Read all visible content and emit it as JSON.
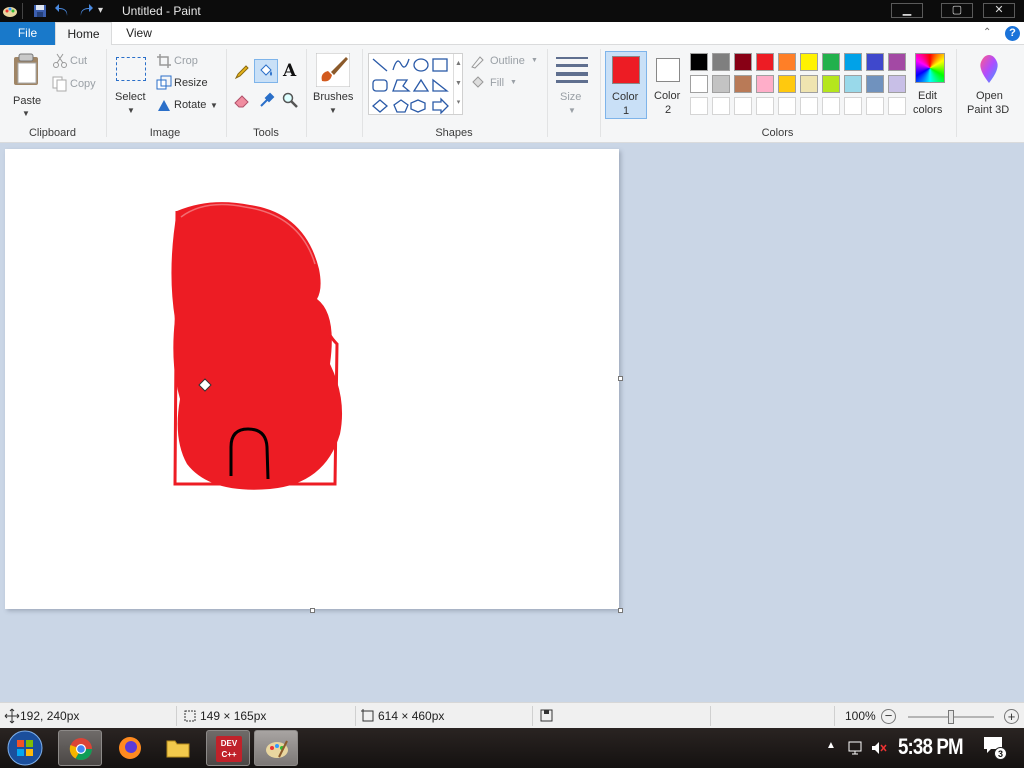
{
  "window": {
    "title": "Untitled - Paint",
    "minimize_symbol": "▁",
    "maximize_symbol": "▢",
    "close_symbol": "✕"
  },
  "menu": {
    "tabs": [
      {
        "label": "File"
      },
      {
        "label": "Home"
      },
      {
        "label": "View"
      }
    ],
    "help_symbol": "?"
  },
  "ribbon": {
    "clipboard": {
      "paste_label": "Paste",
      "cut_label": "Cut",
      "copy_label": "Copy",
      "group_label": "Clipboard"
    },
    "image": {
      "select_label": "Select",
      "crop_label": "Crop",
      "resize_label": "Resize",
      "rotate_label": "Rotate",
      "group_label": "Image"
    },
    "tools": {
      "text_tool_glyph": "A",
      "group_label": "Tools"
    },
    "brushes": {
      "label": "Brushes"
    },
    "shapes": {
      "outline_label": "Outline",
      "fill_label": "Fill",
      "group_label": "Shapes"
    },
    "size": {
      "label": "Size"
    },
    "colors": {
      "color1_label_line1": "Color",
      "color1_label_line2": "1",
      "color2_label_line1": "Color",
      "color2_label_line2": "2",
      "color1_value": "#ed1c24",
      "color2_value": "#ffffff",
      "palette_row1": [
        "#000000",
        "#7f7f7f",
        "#880015",
        "#ed1c24",
        "#ff7f27",
        "#fff200",
        "#22b14c",
        "#00a2e8",
        "#3f48cc",
        "#a349a4"
      ],
      "palette_row2": [
        "#ffffff",
        "#c3c3c3",
        "#b97a57",
        "#ffaec9",
        "#ffc90e",
        "#efe4b0",
        "#b5e61d",
        "#99d9ea",
        "#7092be",
        "#c8bfe7"
      ],
      "edit_colors_line1": "Edit",
      "edit_colors_line2": "colors",
      "group_label": "Colors"
    },
    "paint3d": {
      "label_line1": "Open",
      "label_line2": "Paint 3D"
    }
  },
  "statusbar": {
    "cursor_position": "192, 240px",
    "selection_size": "149 × 165px",
    "image_size": "614 × 460px",
    "zoom_level": "100%",
    "zoom_fraction": 0.5
  },
  "taskbar": {
    "apps": [
      "start-orb",
      "chrome",
      "firefox",
      "file-explorer",
      "dev-cpp",
      "paint"
    ],
    "dev_cpp_label_line1": "DEV",
    "dev_cpp_label_line2": "C++",
    "clock": "5:38 PM",
    "notification_count": "3"
  }
}
